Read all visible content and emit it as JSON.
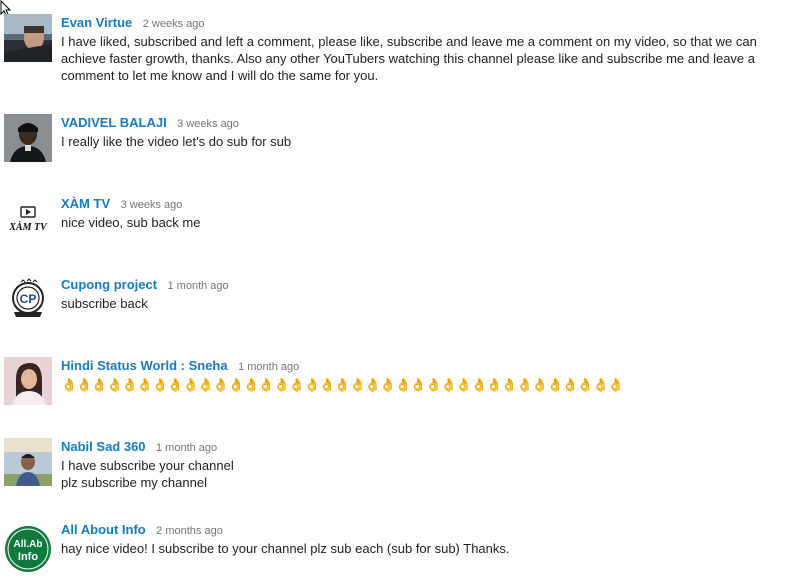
{
  "colors": {
    "author": "#167ac6",
    "time": "#767676",
    "text": "#222222"
  },
  "comments": [
    {
      "author": "Evan Virtue",
      "time": "2 weeks ago",
      "avatar_icon": "car-driver-photo",
      "lines": [
        "I have liked, subscribed and left a comment, please like, subscribe and leave me a comment on my video, so that we can achieve faster growth, thanks. Also any other YouTubers watching this channel please like and subscribe me and leave a comment to let me know and I will do the same for you."
      ]
    },
    {
      "author": "VADIVEL BALAJI",
      "time": "3 weeks ago",
      "avatar_icon": "man-portrait-photo",
      "lines": [
        "I really like the video let's do sub for sub"
      ]
    },
    {
      "author": "XÀM TV",
      "time": "3 weeks ago",
      "avatar_icon": "xam-tv-logo",
      "avatar_text": "XÀM TV",
      "lines": [
        "nice video, sub back me"
      ]
    },
    {
      "author": "Cupong project",
      "time": "1 month ago",
      "avatar_icon": "cupong-project-badge-logo",
      "lines": [
        "subscribe back"
      ]
    },
    {
      "author": "Hindi Status World : Sneha",
      "time": "1 month ago",
      "avatar_icon": "woman-portrait-photo",
      "lines": [
        "👌👌👌👌👌👌👌👌👌👌👌👌👌👌👌👌👌👌👌👌👌👌👌👌👌👌👌👌👌👌👌👌👌👌👌👌👌"
      ]
    },
    {
      "author": "Nabil Sad 360",
      "time": "1 month ago",
      "avatar_icon": "man-outdoor-photo",
      "lines": [
        "I have subscribe your channel",
        "plz subscribe my channel"
      ]
    },
    {
      "author": "All About Info",
      "time": "2 months ago",
      "avatar_icon": "all-about-info-logo",
      "avatar_text": "All.Ab Info",
      "lines": [
        "hay nice video! I subscribe to your channel plz sub each (sub for sub) Thanks."
      ]
    }
  ]
}
